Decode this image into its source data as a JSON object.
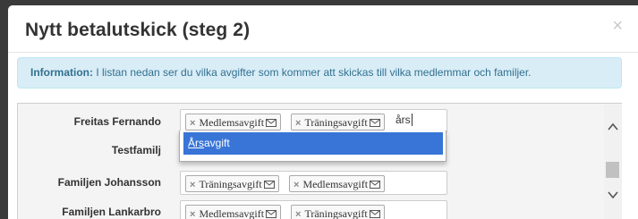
{
  "modal": {
    "title": "Nytt betalutskick (steg 2)",
    "close_label": "×"
  },
  "alert": {
    "label": "Information:",
    "text": " I listan nedan ser du vilka avgifter som kommer att skickas till vilka medlemmar och familjer."
  },
  "rows": [
    {
      "label": "Freitas Fernando",
      "tags": [
        "Medlemsavgift",
        "Träningsavgift"
      ],
      "input_value": "års"
    },
    {
      "label": "Testfamilj",
      "tags": []
    },
    {
      "label": "Familjen Johansson",
      "tags": [
        "Träningsavgift",
        "Medlemsavgift"
      ]
    },
    {
      "label": "Familjen Lankarbro",
      "tags": [
        "Medlemsavgift",
        "Träningsavgift"
      ]
    }
  ],
  "dropdown": {
    "match": "Års",
    "rest": "avgift"
  },
  "tag_remove_glyph": "×",
  "colors": {
    "alert_bg": "#d9edf7",
    "alert_text": "#31708f",
    "highlight": "#3875d7"
  },
  "icons": {
    "tag_icon": "envelope-icon",
    "close": "close-icon"
  }
}
